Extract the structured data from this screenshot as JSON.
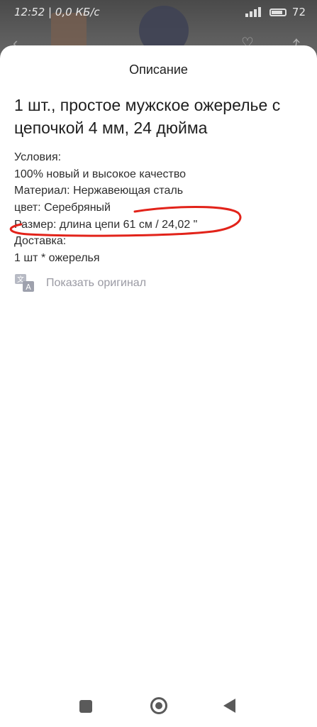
{
  "status_bar": {
    "time": "12:52 | 0,0 КБ/с",
    "battery": "72"
  },
  "sheet": {
    "title": "Описание",
    "product_title": "1 шт., простое мужское ожерелье с цепочкой 4 мм, 24 дюйма",
    "description_lines": [
      "Условия:",
      "100% новый и высокое качество",
      "Материал: Нержавеющая сталь",
      "цвет: Серебряный",
      "Размер: длина цепи 61 см / 24,02 \"",
      "Доставка:",
      "1 шт * ожерелья"
    ],
    "show_original_label": "Показать оригинал",
    "annotation_color": "#e2231a"
  },
  "icons": {
    "translate": "translate-icon",
    "back": "back-arrow-icon",
    "heart": "heart-icon",
    "share": "share-icon",
    "nav_recents": "recents-square-icon",
    "nav_home": "home-circle-icon",
    "nav_back": "back-triangle-icon"
  },
  "colors": {
    "sheet_background": "#ffffff",
    "text_primary": "#1f1f1f",
    "text_muted": "#9a9aa3",
    "nav_icon": "#5a5a5a"
  }
}
